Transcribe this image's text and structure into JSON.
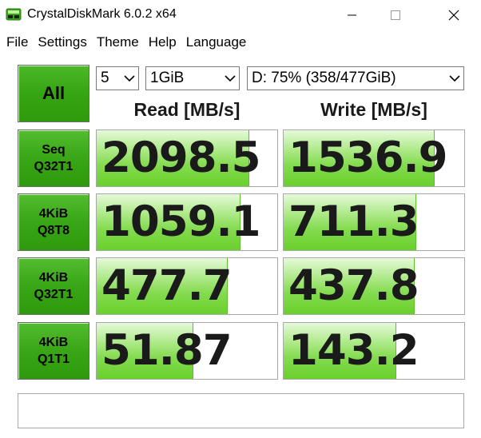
{
  "window": {
    "title": "CrystalDiskMark 6.0.2 x64",
    "icons": {
      "app": "crystaldiskmark-app-icon",
      "minimize": "minimize-icon",
      "maximize": "maximize-icon",
      "close": "close-icon"
    }
  },
  "menu": [
    "File",
    "Settings",
    "Theme",
    "Help",
    "Language"
  ],
  "toolbar": {
    "all_label": "All",
    "count": "5",
    "size": "1GiB",
    "drive": "D: 75% (358/477GiB)"
  },
  "headers": {
    "read": "Read [MB/s]",
    "write": "Write [MB/s]"
  },
  "tests": [
    {
      "line1": "Seq",
      "line2": "Q32T1",
      "read": "2098.5",
      "write": "1536.9",
      "read_fill": 0.84,
      "write_fill": 0.83
    },
    {
      "line1": "4KiB",
      "line2": "Q8T8",
      "read": "1059.1",
      "write": "711.3",
      "read_fill": 0.79,
      "write_fill": 0.73
    },
    {
      "line1": "4KiB",
      "line2": "Q32T1",
      "read": "477.7",
      "write": "437.8",
      "read_fill": 0.72,
      "write_fill": 0.72
    },
    {
      "line1": "4KiB",
      "line2": "Q1T1",
      "read": "51.87",
      "write": "143.2",
      "read_fill": 0.53,
      "write_fill": 0.62
    }
  ],
  "colors": {
    "button_green": "#38a616",
    "bar_green": "#6ad02c"
  },
  "status_text": ""
}
